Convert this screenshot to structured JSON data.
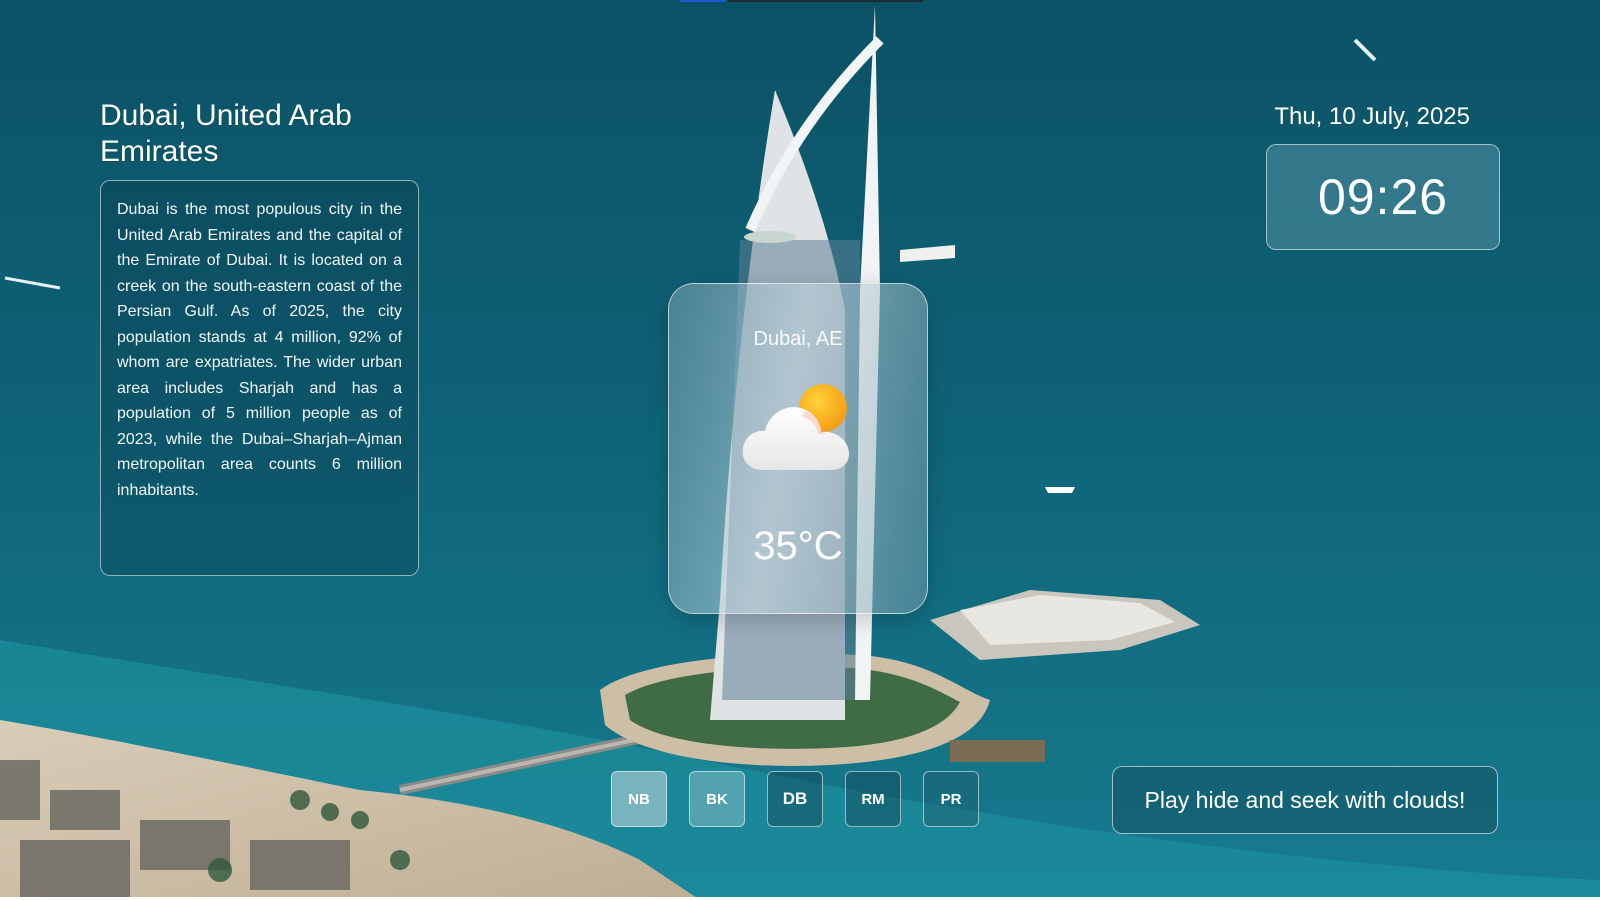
{
  "city": {
    "title": "Dubai, United Arab Emirates",
    "description": "Dubai is the most populous city in the United Arab Emirates and the capital of the Emirate of Dubai. It is located on a creek on the south-eastern coast of the Persian Gulf. As of 2025, the city population stands at 4 million, 92% of whom are expatriates. The wider urban area includes Sharjah and has a population of 5 million people as of 2023, while the Dubai–Sharjah–Ajman metropolitan area counts 6 million inhabitants."
  },
  "datetime": {
    "date": "Thu, 10 July, 2025",
    "time": "09:26"
  },
  "weather": {
    "location": "Dubai, AE",
    "icon": "partly-cloudy-icon",
    "temperature": "35°C"
  },
  "city_buttons": [
    {
      "code": "NB"
    },
    {
      "code": "BK"
    },
    {
      "code": "DB",
      "selected": true
    },
    {
      "code": "RM"
    },
    {
      "code": "PR"
    }
  ],
  "game_button": {
    "label": "Play hide and seek with clouds!"
  },
  "colors": {
    "sea": "#0f6276",
    "shallow_water": "#1b8a9a",
    "sun": "#f6b21a",
    "cloud": "#f4f4f4"
  }
}
